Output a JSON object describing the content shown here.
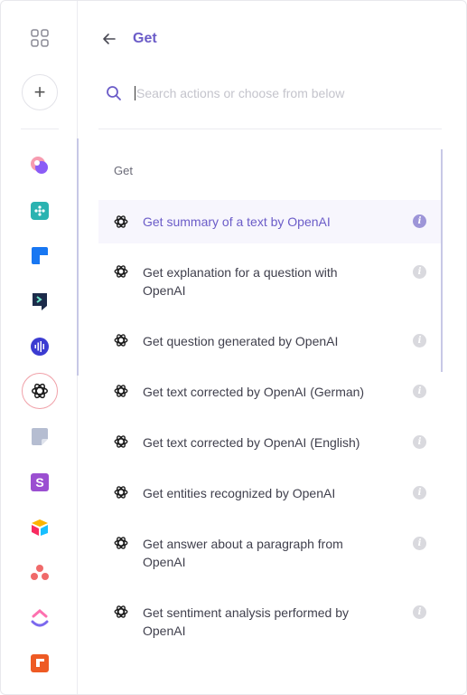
{
  "header": {
    "title": "Get"
  },
  "search": {
    "placeholder": "Search actions or choose from below",
    "value": ""
  },
  "sidebar": {
    "add_label": "+",
    "apps": [
      {
        "name": "app-pink-purple",
        "colors": [
          "#f25c7a",
          "#8b5cf6"
        ]
      },
      {
        "name": "app-teal-dots",
        "colors": [
          "#2bb3b1"
        ]
      },
      {
        "name": "app-trello",
        "colors": [
          "#1877f2"
        ]
      },
      {
        "name": "app-dark-arrow",
        "colors": [
          "#1c2b4a"
        ]
      },
      {
        "name": "app-soundwave",
        "colors": [
          "#3b3bd1"
        ]
      },
      {
        "name": "app-openai",
        "colors": [
          "#1a1a1a"
        ],
        "active": true
      },
      {
        "name": "app-note",
        "colors": [
          "#9aa5bf"
        ]
      },
      {
        "name": "app-s-purple",
        "colors": [
          "#9b4fd1"
        ]
      },
      {
        "name": "app-airtable",
        "colors": [
          "#fcb400",
          "#18bfff",
          "#f82b60"
        ]
      },
      {
        "name": "app-asana",
        "colors": [
          "#f06a6a"
        ]
      },
      {
        "name": "app-clickup",
        "colors": [
          "#7b68ee",
          "#fd71af",
          "#ffc800"
        ]
      },
      {
        "name": "app-orange-c",
        "colors": [
          "#ee5a24"
        ]
      }
    ]
  },
  "list": {
    "group_label": "Get",
    "items": [
      {
        "label": "Get summary of a text by OpenAI",
        "selected": true
      },
      {
        "label": "Get explanation for a question with OpenAI"
      },
      {
        "label": "Get question generated by OpenAI"
      },
      {
        "label": "Get text corrected by OpenAI (German)"
      },
      {
        "label": "Get text corrected by OpenAI (English)"
      },
      {
        "label": "Get entities recognized by OpenAI"
      },
      {
        "label": "Get answer about a paragraph from OpenAI"
      },
      {
        "label": "Get sentiment analysis performed by OpenAI"
      }
    ],
    "info_glyph": "i"
  },
  "colors": {
    "accent": "#6b5cc8",
    "selected_bg": "#f7f6fd"
  }
}
